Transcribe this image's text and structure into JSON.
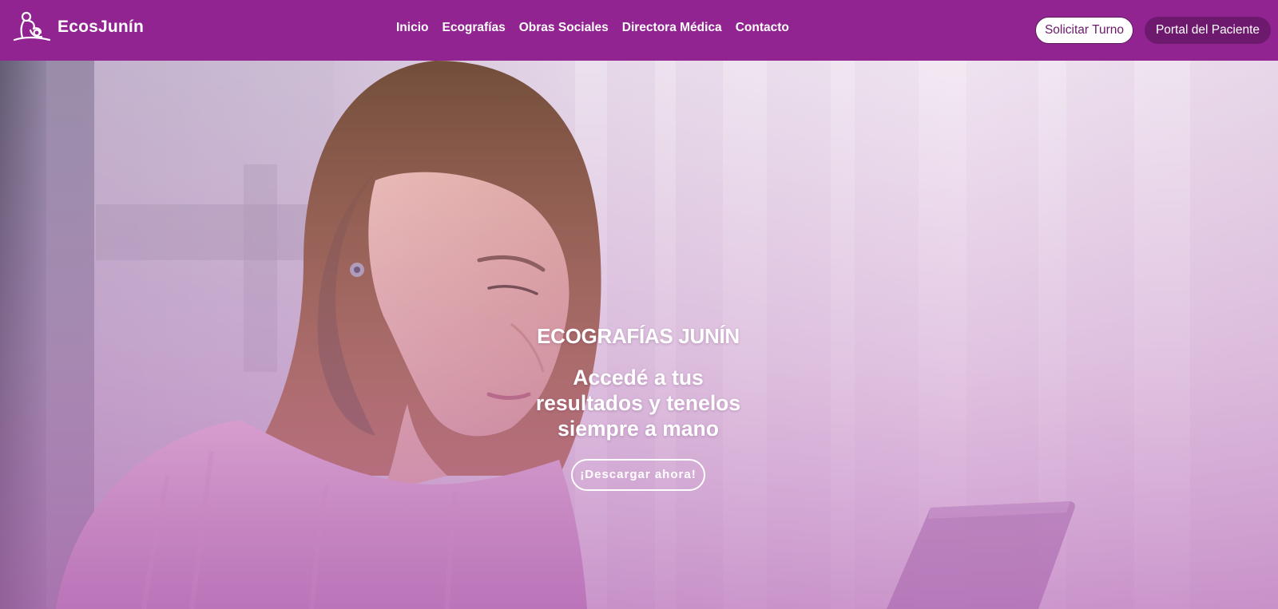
{
  "brand": {
    "name": "EcosJunín",
    "logo_icon": "mother-child-icon"
  },
  "nav": {
    "items": [
      {
        "label": "Inicio"
      },
      {
        "label": "Ecografías"
      },
      {
        "label": "Obras Sociales"
      },
      {
        "label": "Directora Médica"
      },
      {
        "label": "Contacto"
      }
    ]
  },
  "actions": {
    "solicitar_turno": "Solicitar Turno",
    "portal_paciente": "Portal del Paciente"
  },
  "hero": {
    "kicker": "ECOGRAFÍAS JUNÍN",
    "headline_line1": "Accedé a tus",
    "headline_line2": "resultados y tenelos",
    "headline_line3": "siempre a mano",
    "cta": "¡Descargar ahora!",
    "photo_subject": "woman-with-laptop-photo"
  },
  "colors": {
    "nav_background": "#922491",
    "portal_button": "#6d1a6e",
    "turno_button_text": "#6b1a6b",
    "hero_tint": "#c88cc8"
  }
}
